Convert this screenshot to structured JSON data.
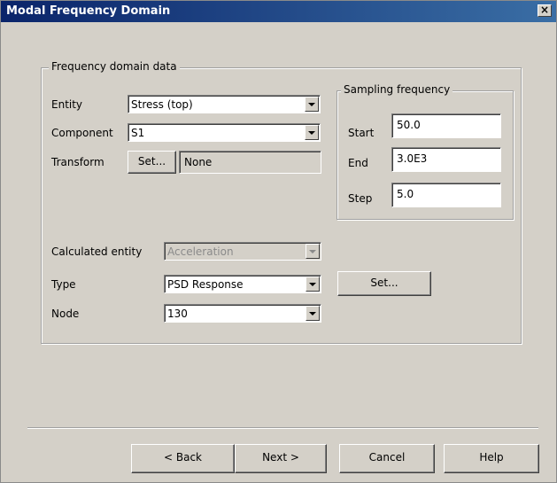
{
  "window": {
    "title": "Modal Frequency Domain"
  },
  "group": {
    "title": "Frequency domain data",
    "entity": {
      "label": "Entity",
      "value": "Stress (top)"
    },
    "component": {
      "label": "Component",
      "value": "S1"
    },
    "transform": {
      "label": "Transform",
      "button": "Set...",
      "value": "None"
    },
    "calculated_entity": {
      "label": "Calculated entity",
      "value": "Acceleration"
    },
    "type": {
      "label": "Type",
      "value": "PSD Response",
      "button": "Set..."
    },
    "node": {
      "label": "Node",
      "value": "130"
    }
  },
  "sampling": {
    "title": "Sampling frequency",
    "start": {
      "label": "Start",
      "value": "50.0"
    },
    "end": {
      "label": "End",
      "value": "3.0E3"
    },
    "step": {
      "label": "Step",
      "value": "5.0"
    }
  },
  "buttons": {
    "back": "< Back",
    "next": "Next >",
    "cancel": "Cancel",
    "help": "Help"
  }
}
